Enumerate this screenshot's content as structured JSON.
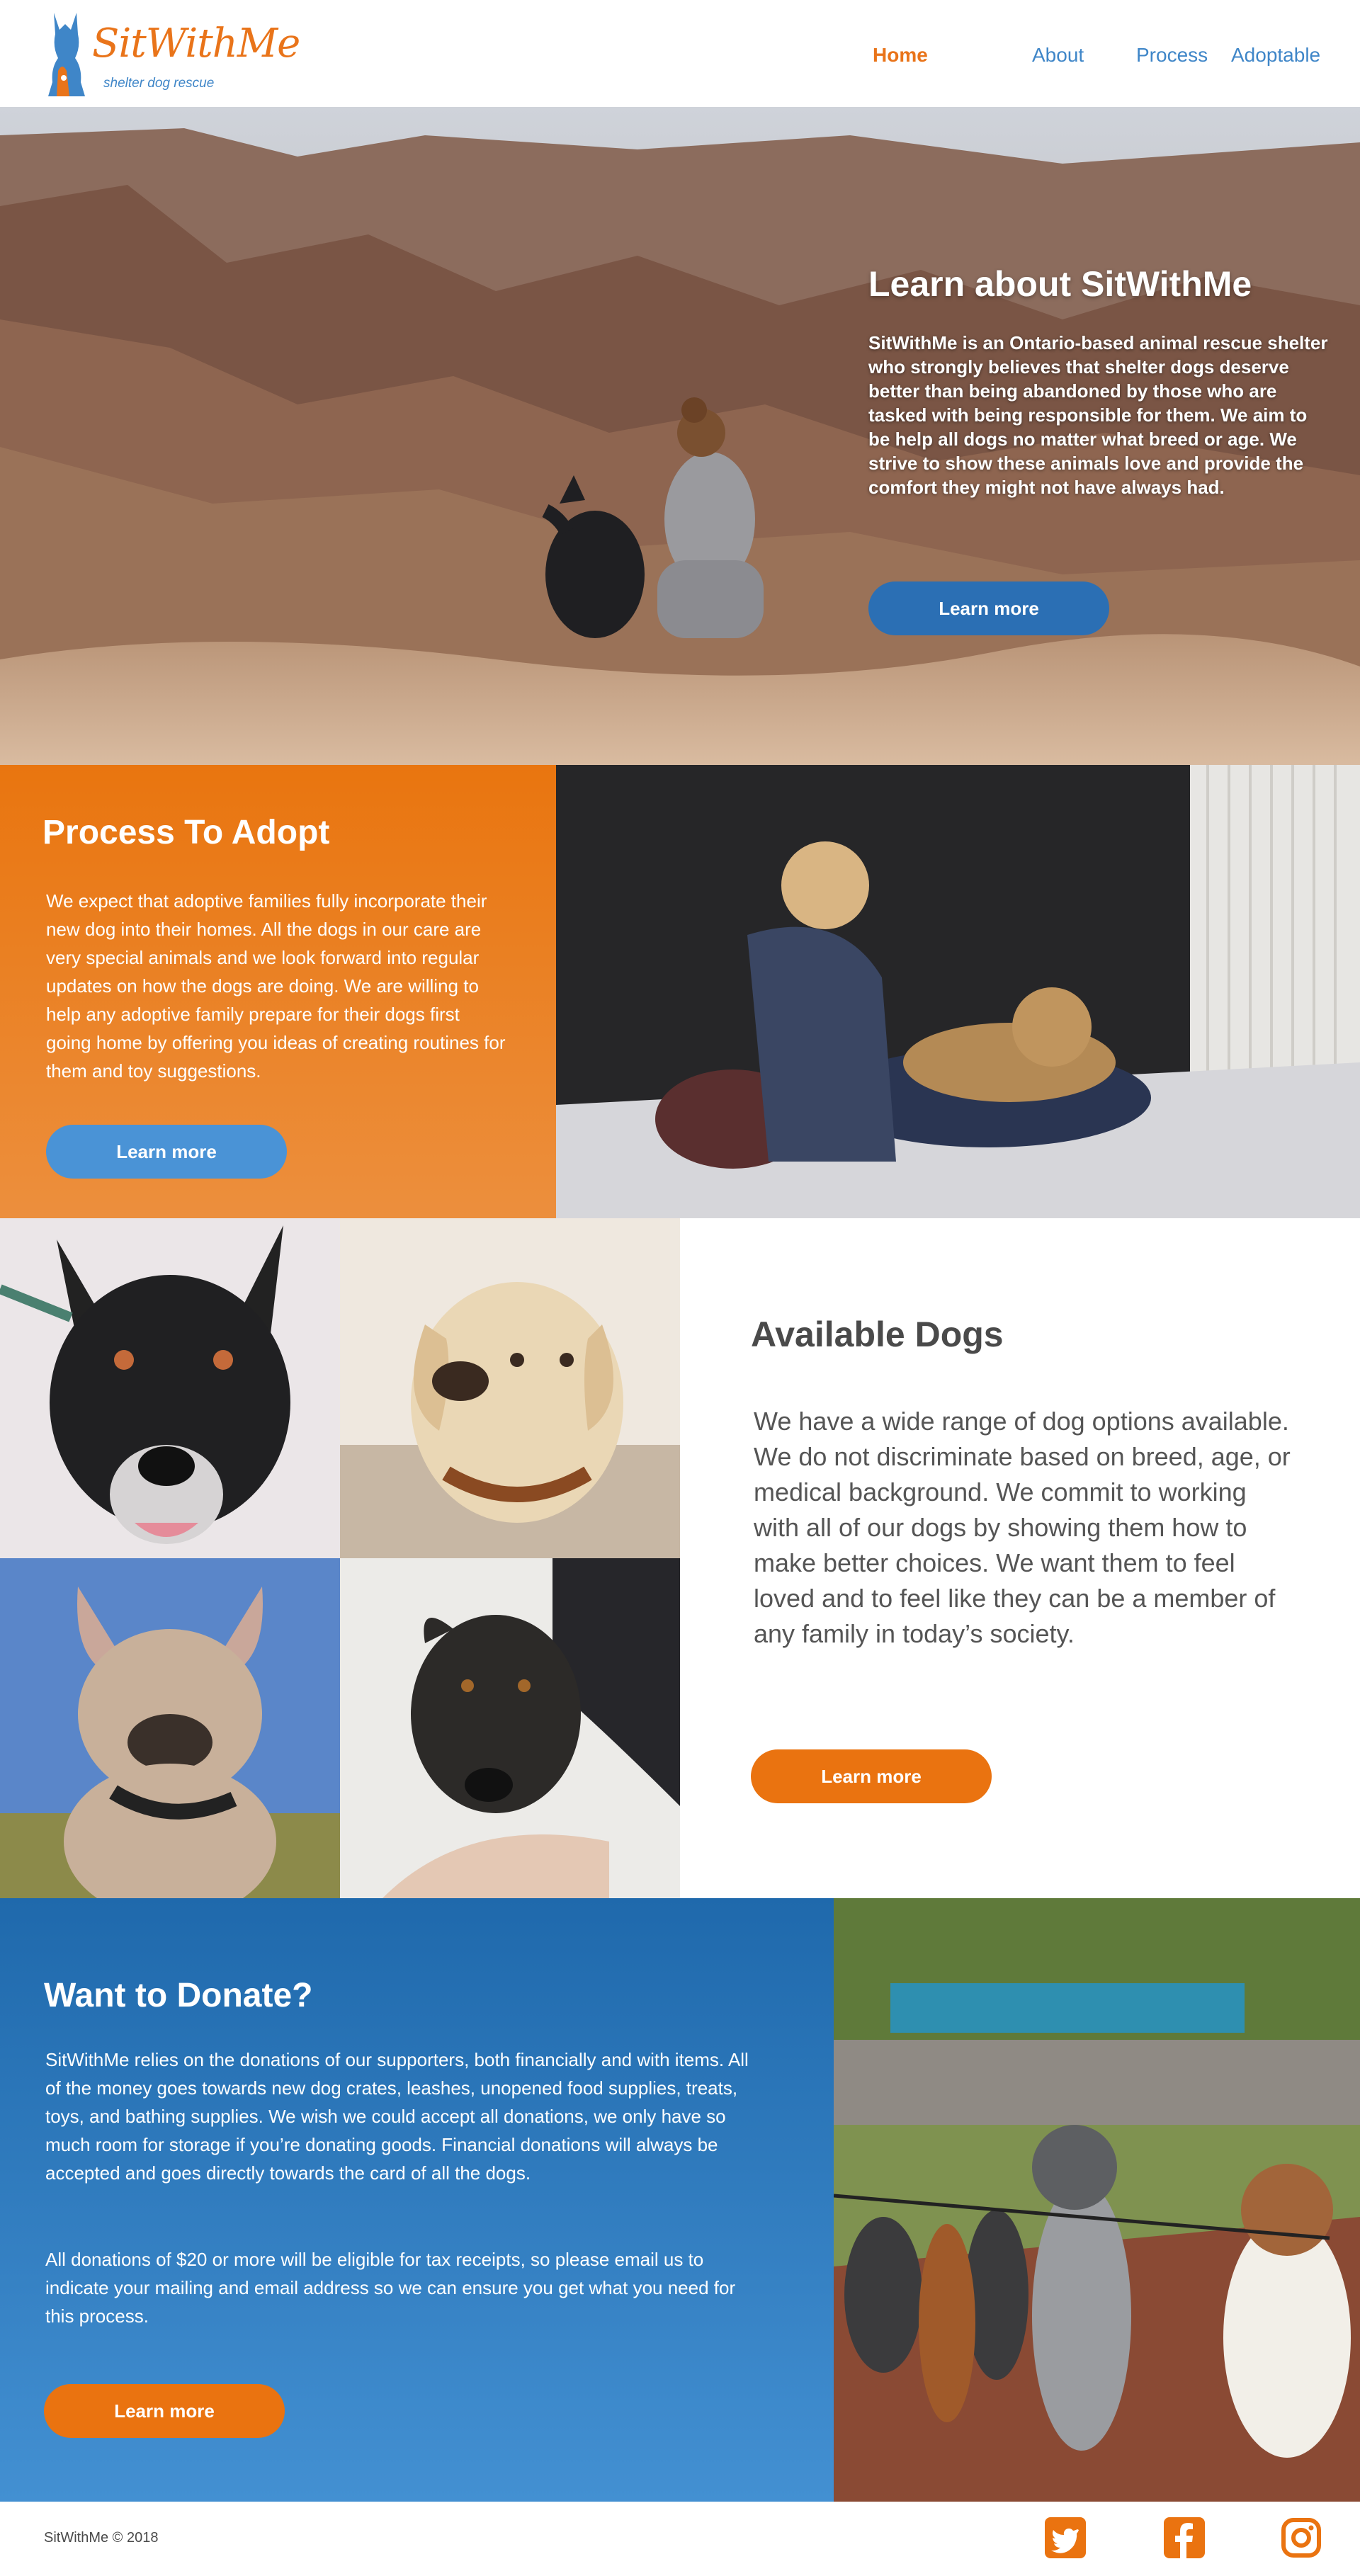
{
  "brand": {
    "name": "SitWithMe",
    "tagline": "shelter dog rescue"
  },
  "nav": {
    "items": [
      {
        "label": "Home",
        "active": true
      },
      {
        "label": "About",
        "active": false
      },
      {
        "label": "Process",
        "active": false
      },
      {
        "label": "Adoptable",
        "active": false
      }
    ]
  },
  "hero": {
    "title": "Learn about SitWithMe",
    "body": "SitWithMe is an Ontario-based animal rescue shelter who strongly believes that shelter dogs deserve better than being abandoned by those who are tasked with being responsible for them.  We aim to be help all dogs no matter what breed or age. We strive to show these animals love and provide the comfort they might not have always had.",
    "button": "Learn more"
  },
  "process": {
    "title": "Process To Adopt",
    "body": "We expect that adoptive families fully incorporate their new dog into their homes. All the dogs in our care are very special animals and we look forward into regular updates on how the dogs are doing. We are willing to help any adoptive family prepare for their dogs first going home by offering you ideas of creating routines for them and toy suggestions.",
    "button": "Learn more"
  },
  "dogs": {
    "title": "Available Dogs",
    "body": "We have a wide range of dog options available. We do not discriminate based on breed, age, or medical background. We commit to working with all of our dogs by showing them how to make better choices. We want them to feel loved and to feel like they can be a member of any family in today’s society.",
    "button": "Learn more"
  },
  "donate": {
    "title": "Want to Donate?",
    "p1": "SitWithMe relies on the donations of our supporters, both financially and with items. All of the money goes towards new dog crates, leashes, unopened food supplies, treats, toys, and bathing supplies. We wish we could accept all donations, we only have so much room for storage if you’re donating goods. Financial donations will always be accepted and goes directly towards the card of all the dogs.",
    "p2": "All donations of $20 or more will be eligible for tax receipts, so please email us to indicate your mailing and email address so we can ensure you get what you need for this process.",
    "button": "Learn more"
  },
  "footer": {
    "copyright": "SitWithMe © 2018",
    "social": [
      "twitter-icon",
      "facebook-icon",
      "instagram-icon"
    ]
  },
  "colors": {
    "orange": "#e9741a",
    "blue": "#3f86c8",
    "dark_blue": "#2b6fb4"
  }
}
